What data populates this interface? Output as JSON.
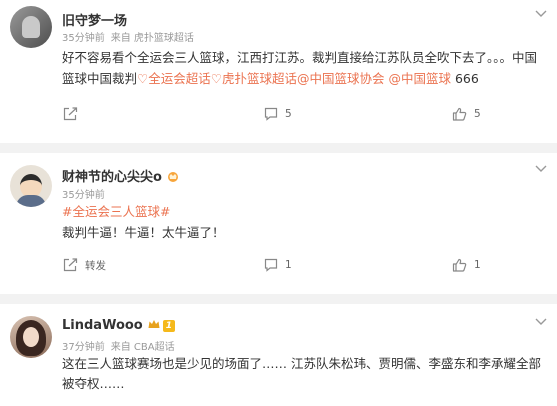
{
  "comments": [
    {
      "username": "旧守梦一场",
      "time": "35分钟前",
      "source": "来自 虎扑篮球超话",
      "text_part1": "好不容易看个全运会三人篮球，江西打江苏。裁判直接给江苏队员全吹下去了。。。中国篮球中国裁判",
      "link1": "全运会超话",
      "link2": "虎扑篮球超话",
      "link3": "@中国篮球协会",
      "link4": "@中国篮球",
      "text_part2": " 666",
      "actions": {
        "repost": "",
        "comment": "5",
        "like": "5"
      }
    },
    {
      "username": "财神节的心尖尖o",
      "time": "35分钟前",
      "topic": "#全运会三人篮球#",
      "text": "裁判牛逼！牛逼！太牛逼了！",
      "actions": {
        "repost": "转发",
        "comment": "1",
        "like": "1"
      }
    },
    {
      "username": "LindaWooo",
      "vip_level": "1",
      "time": "37分钟前",
      "source": "来自 CBA超话",
      "text": "这在三人篮球赛场也是少见的场面了…… 江苏队朱松玮、贾明儒、李盛东和李承耀全部被夺权……"
    }
  ],
  "colors": {
    "link": "#eb7350",
    "meta": "#999999",
    "background": "#f2f2f2"
  }
}
